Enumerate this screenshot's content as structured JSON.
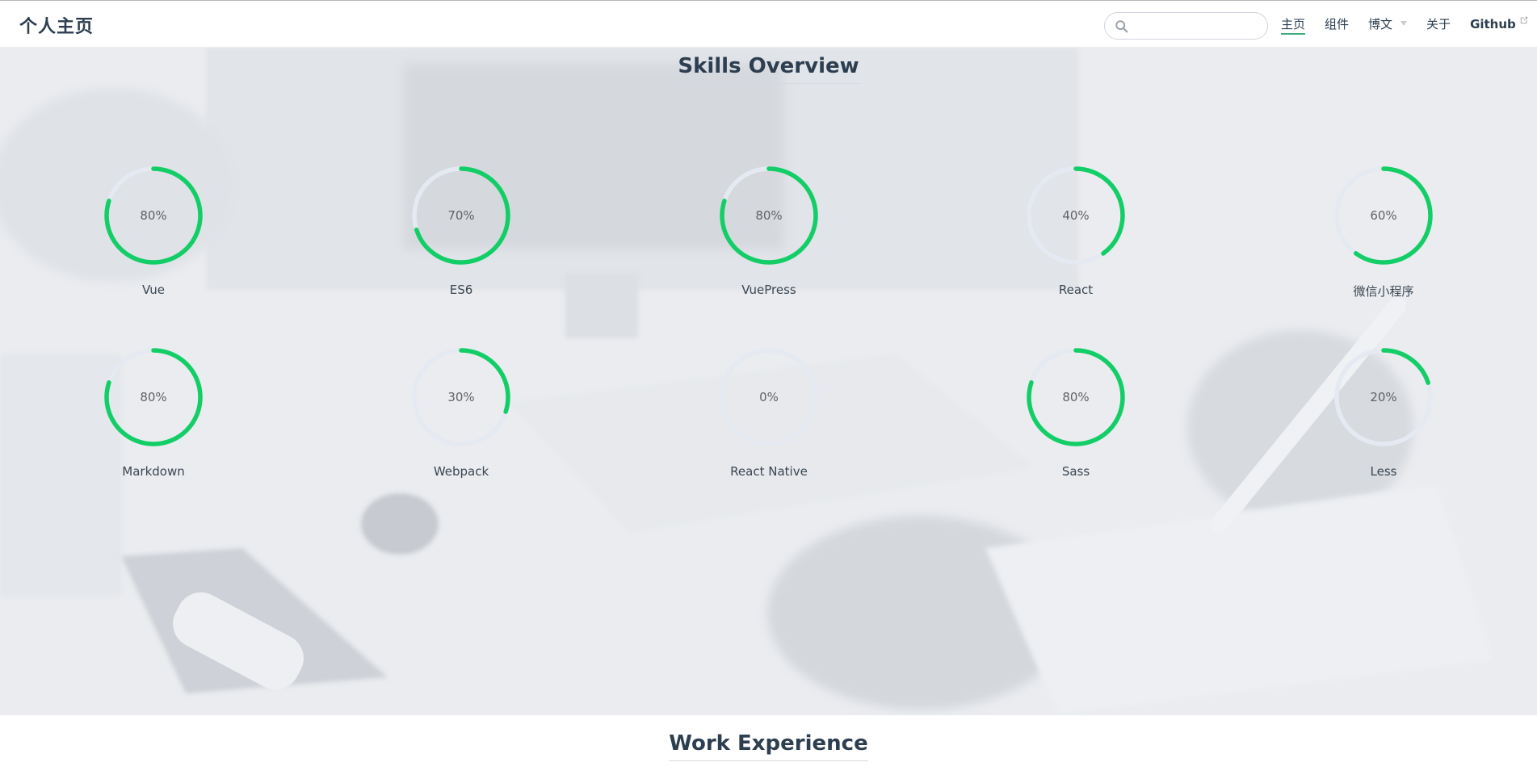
{
  "navbar": {
    "site_name": "个人主页",
    "search": {
      "value": "",
      "placeholder": ""
    },
    "links": [
      {
        "label": "主页",
        "active": true
      },
      {
        "label": "组件"
      },
      {
        "label": "博文",
        "dropdown": true
      },
      {
        "label": "关于"
      },
      {
        "label": "Github",
        "external": true
      }
    ]
  },
  "colors": {
    "accent": "#3eaf7c",
    "progress": "#13ce66",
    "track": "#e5e9f2"
  },
  "skills_section": {
    "title": "Skills Overview",
    "skills": [
      {
        "name": "Vue",
        "percent": 80,
        "label": "80%"
      },
      {
        "name": "ES6",
        "percent": 70,
        "label": "70%"
      },
      {
        "name": "VuePress",
        "percent": 80,
        "label": "80%"
      },
      {
        "name": "React",
        "percent": 40,
        "label": "40%"
      },
      {
        "name": "微信小程序",
        "percent": 60,
        "label": "60%"
      },
      {
        "name": "Markdown",
        "percent": 80,
        "label": "80%"
      },
      {
        "name": "Webpack",
        "percent": 30,
        "label": "30%"
      },
      {
        "name": "React Native",
        "percent": 0,
        "label": "0%"
      },
      {
        "name": "Sass",
        "percent": 80,
        "label": "80%"
      },
      {
        "name": "Less",
        "percent": 20,
        "label": "20%"
      }
    ]
  },
  "work_section": {
    "title": "Work Experience"
  }
}
